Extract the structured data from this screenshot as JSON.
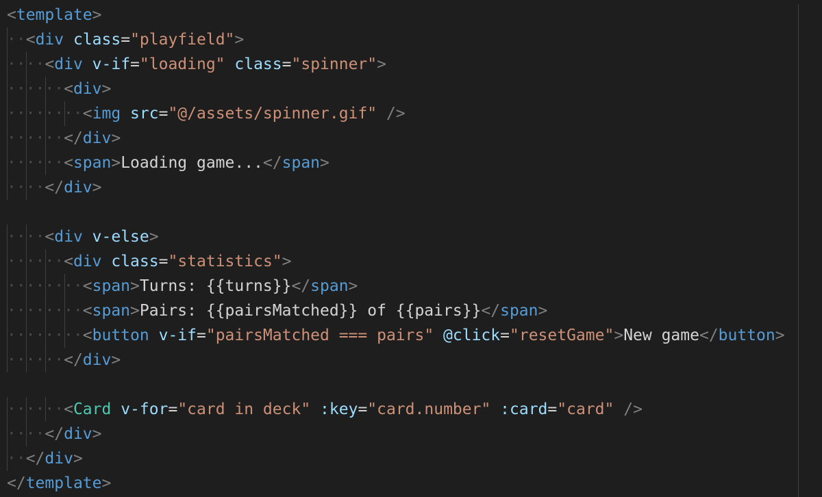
{
  "colors": {
    "background": "#1e1e1e",
    "punctuation": "#808080",
    "tag": "#569cd6",
    "component": "#4ec9b0",
    "attribute": "#9cdcfe",
    "string": "#ce9178",
    "text": "#d4d4d4",
    "indent_guide": "#404040",
    "whitespace": "#4a4a4a"
  },
  "code": [
    {
      "indent": 0,
      "tokens": [
        [
          "punct",
          "<"
        ],
        [
          "tag",
          "template"
        ],
        [
          "punct",
          ">"
        ]
      ]
    },
    {
      "indent": 1,
      "tokens": [
        [
          "punct",
          "<"
        ],
        [
          "tag",
          "div"
        ],
        [
          "text",
          " "
        ],
        [
          "attr",
          "class"
        ],
        [
          "text",
          "="
        ],
        [
          "string",
          "\"playfield\""
        ],
        [
          "punct",
          ">"
        ]
      ]
    },
    {
      "indent": 2,
      "tokens": [
        [
          "punct",
          "<"
        ],
        [
          "tag",
          "div"
        ],
        [
          "text",
          " "
        ],
        [
          "attr",
          "v-if"
        ],
        [
          "text",
          "="
        ],
        [
          "string",
          "\"loading\""
        ],
        [
          "text",
          " "
        ],
        [
          "attr",
          "class"
        ],
        [
          "text",
          "="
        ],
        [
          "string",
          "\"spinner\""
        ],
        [
          "punct",
          ">"
        ]
      ]
    },
    {
      "indent": 3,
      "tokens": [
        [
          "punct",
          "<"
        ],
        [
          "tag",
          "div"
        ],
        [
          "punct",
          ">"
        ]
      ]
    },
    {
      "indent": 4,
      "tokens": [
        [
          "punct",
          "<"
        ],
        [
          "tag",
          "img"
        ],
        [
          "text",
          " "
        ],
        [
          "attr",
          "src"
        ],
        [
          "text",
          "="
        ],
        [
          "string",
          "\"@/assets/spinner.gif\""
        ],
        [
          "text",
          " "
        ],
        [
          "punct",
          "/>"
        ]
      ]
    },
    {
      "indent": 3,
      "tokens": [
        [
          "punct",
          "</"
        ],
        [
          "tag",
          "div"
        ],
        [
          "punct",
          ">"
        ]
      ]
    },
    {
      "indent": 3,
      "tokens": [
        [
          "punct",
          "<"
        ],
        [
          "tag",
          "span"
        ],
        [
          "punct",
          ">"
        ],
        [
          "text",
          "Loading game..."
        ],
        [
          "punct",
          "</"
        ],
        [
          "tag",
          "span"
        ],
        [
          "punct",
          ">"
        ]
      ]
    },
    {
      "indent": 2,
      "tokens": [
        [
          "punct",
          "</"
        ],
        [
          "tag",
          "div"
        ],
        [
          "punct",
          ">"
        ]
      ]
    },
    {
      "indent": 0,
      "tokens": []
    },
    {
      "indent": 2,
      "tokens": [
        [
          "punct",
          "<"
        ],
        [
          "tag",
          "div"
        ],
        [
          "text",
          " "
        ],
        [
          "attr",
          "v-else"
        ],
        [
          "punct",
          ">"
        ]
      ]
    },
    {
      "indent": 3,
      "tokens": [
        [
          "punct",
          "<"
        ],
        [
          "tag",
          "div"
        ],
        [
          "text",
          " "
        ],
        [
          "attr",
          "class"
        ],
        [
          "text",
          "="
        ],
        [
          "string",
          "\"statistics\""
        ],
        [
          "punct",
          ">"
        ]
      ]
    },
    {
      "indent": 4,
      "tokens": [
        [
          "punct",
          "<"
        ],
        [
          "tag",
          "span"
        ],
        [
          "punct",
          ">"
        ],
        [
          "text",
          "Turns: {{turns}}"
        ],
        [
          "punct",
          "</"
        ],
        [
          "tag",
          "span"
        ],
        [
          "punct",
          ">"
        ]
      ]
    },
    {
      "indent": 4,
      "tokens": [
        [
          "punct",
          "<"
        ],
        [
          "tag",
          "span"
        ],
        [
          "punct",
          ">"
        ],
        [
          "text",
          "Pairs: {{pairsMatched}} of {{pairs}}"
        ],
        [
          "punct",
          "</"
        ],
        [
          "tag",
          "span"
        ],
        [
          "punct",
          ">"
        ]
      ]
    },
    {
      "indent": 4,
      "tokens": [
        [
          "punct",
          "<"
        ],
        [
          "tag",
          "button"
        ],
        [
          "text",
          " "
        ],
        [
          "attr",
          "v-if"
        ],
        [
          "text",
          "="
        ],
        [
          "string",
          "\"pairsMatched === pairs\""
        ],
        [
          "text",
          " "
        ],
        [
          "attr",
          "@click"
        ],
        [
          "text",
          "="
        ],
        [
          "string",
          "\"resetGame\""
        ],
        [
          "punct",
          ">"
        ],
        [
          "text",
          "New game"
        ],
        [
          "punct",
          "</"
        ],
        [
          "tag",
          "button"
        ],
        [
          "punct",
          ">"
        ]
      ]
    },
    {
      "indent": 3,
      "tokens": [
        [
          "punct",
          "</"
        ],
        [
          "tag",
          "div"
        ],
        [
          "punct",
          ">"
        ]
      ]
    },
    {
      "indent": 0,
      "tokens": []
    },
    {
      "indent": 3,
      "tokens": [
        [
          "punct",
          "<"
        ],
        [
          "component",
          "Card"
        ],
        [
          "text",
          " "
        ],
        [
          "attr",
          "v-for"
        ],
        [
          "text",
          "="
        ],
        [
          "string",
          "\"card in deck\""
        ],
        [
          "text",
          " "
        ],
        [
          "attr",
          ":key"
        ],
        [
          "text",
          "="
        ],
        [
          "string",
          "\"card.number\""
        ],
        [
          "text",
          " "
        ],
        [
          "attr",
          ":card"
        ],
        [
          "text",
          "="
        ],
        [
          "string",
          "\"card\""
        ],
        [
          "text",
          " "
        ],
        [
          "punct",
          "/>"
        ]
      ]
    },
    {
      "indent": 2,
      "tokens": [
        [
          "punct",
          "</"
        ],
        [
          "tag",
          "div"
        ],
        [
          "punct",
          ">"
        ]
      ]
    },
    {
      "indent": 1,
      "tokens": [
        [
          "punct",
          "</"
        ],
        [
          "tag",
          "div"
        ],
        [
          "punct",
          ">"
        ]
      ]
    },
    {
      "indent": 0,
      "tokens": [
        [
          "punct",
          "</"
        ],
        [
          "tag",
          "template"
        ],
        [
          "punct",
          ">"
        ]
      ]
    }
  ]
}
